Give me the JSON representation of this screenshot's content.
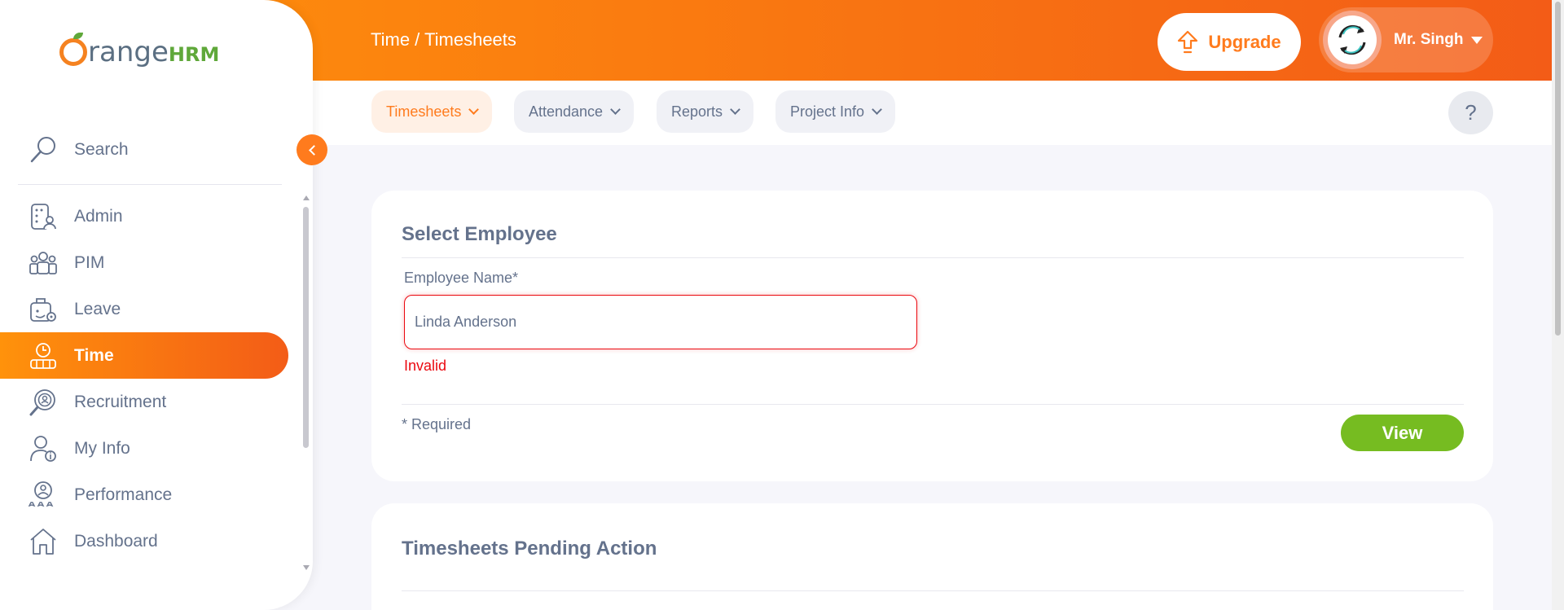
{
  "header": {
    "breadcrumb": "Time / Timesheets",
    "upgrade_label": "Upgrade",
    "user_name": "Mr. Singh"
  },
  "subnav": {
    "tabs": [
      {
        "label": "Timesheets",
        "active": true
      },
      {
        "label": "Attendance",
        "active": false
      },
      {
        "label": "Reports",
        "active": false
      },
      {
        "label": "Project Info",
        "active": false
      }
    ],
    "help_label": "?"
  },
  "sidebar": {
    "logo_text": "range",
    "logo_suffix": "HRM",
    "search_label": "Search",
    "items": [
      {
        "label": "Admin",
        "icon": "admin-icon"
      },
      {
        "label": "PIM",
        "icon": "pim-icon"
      },
      {
        "label": "Leave",
        "icon": "leave-icon"
      },
      {
        "label": "Time",
        "icon": "time-icon",
        "active": true
      },
      {
        "label": "Recruitment",
        "icon": "recruitment-icon"
      },
      {
        "label": "My Info",
        "icon": "my-info-icon"
      },
      {
        "label": "Performance",
        "icon": "performance-icon"
      },
      {
        "label": "Dashboard",
        "icon": "dashboard-icon"
      }
    ]
  },
  "select_employee": {
    "title": "Select Employee",
    "field_label": "Employee Name*",
    "field_value": "Linda Anderson",
    "error": "Invalid",
    "required_note": "* Required",
    "view_label": "View"
  },
  "pending": {
    "title": "Timesheets Pending Action"
  },
  "colors": {
    "accent": "#ff7b1d",
    "gradient_start": "#ff920b",
    "gradient_end": "#f35c17",
    "success": "#76bc21",
    "error": "#eb0910"
  }
}
